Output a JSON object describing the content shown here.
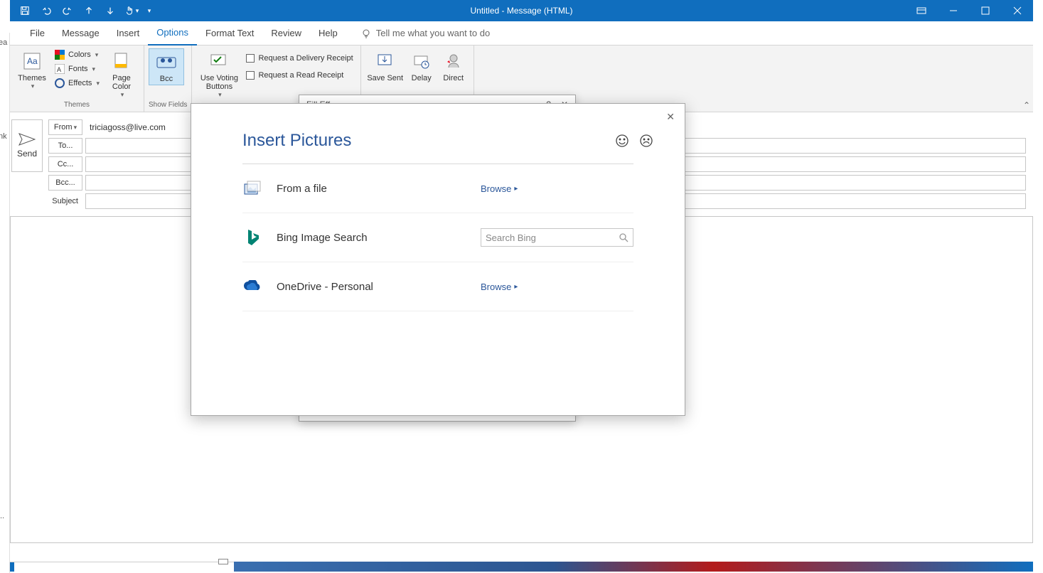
{
  "window": {
    "title": "Untitled  -  Message (HTML)"
  },
  "tabs": {
    "file": "File",
    "message": "Message",
    "insert": "Insert",
    "options": "Options",
    "format": "Format Text",
    "review": "Review",
    "help": "Help",
    "tellme": "Tell me what you want to do"
  },
  "ribbon": {
    "themes": {
      "btn": "Themes",
      "colors": "Colors",
      "fonts": "Fonts",
      "effects": "Effects",
      "group": "Themes"
    },
    "pagecolor": "Page\nColor",
    "bcc": "Bcc",
    "showfields": "Show Fields",
    "voting": "Use Voting\nButtons",
    "delivery": "Request a Delivery Receipt",
    "read": "Request a Read Receipt",
    "savesent": "Save Sent",
    "delay": "Delay",
    "direct": "Direct"
  },
  "compose": {
    "send": "Send",
    "from_label": "From",
    "from_value": "triciagoss@live.com",
    "to": "To...",
    "cc": "Cc...",
    "bcc": "Bcc...",
    "subject": "Subject"
  },
  "modal": {
    "title": "Insert Pictures",
    "file_label": "From a file",
    "file_action": "Browse",
    "bing_label": "Bing Image Search",
    "bing_placeholder": "Search Bing",
    "onedrive_label": "OneDrive - Personal",
    "onedrive_action": "Browse"
  },
  "behind": {
    "frag": "Fill Eff"
  },
  "left": {
    "t1": "ea",
    "t2": "nk"
  }
}
